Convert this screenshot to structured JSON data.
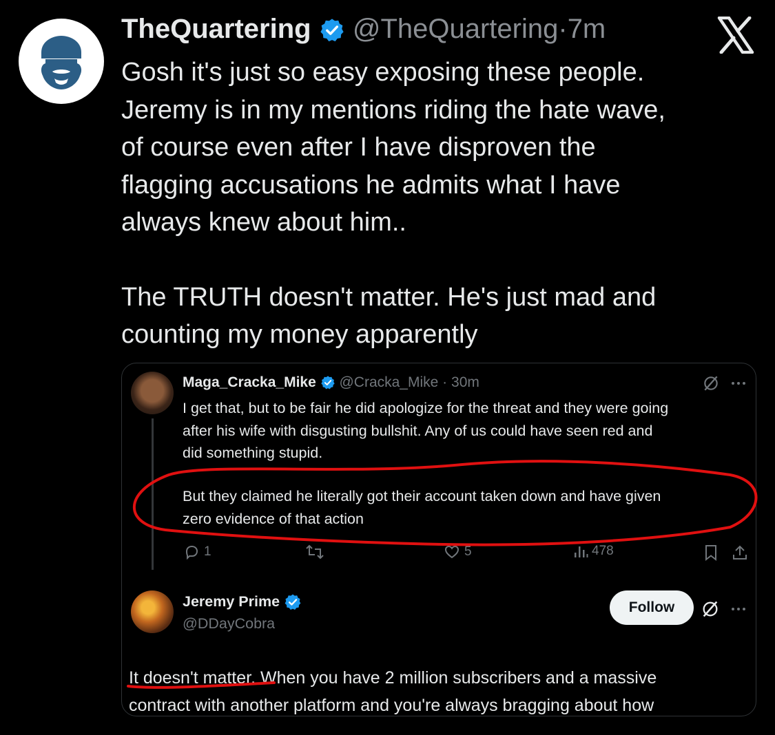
{
  "tweet": {
    "author_name": "TheQuartering",
    "author_handle": "@TheQuartering",
    "separator": "·",
    "time": "7m",
    "lines": [
      "Gosh it's just so easy exposing these people.",
      "Jeremy is in my mentions riding the hate wave,",
      "of course even after I have disproven the",
      "flagging accusations he admits what I have",
      "always knew about him.."
    ],
    "lines2": [
      "The TRUTH doesn't matter.  He's just mad and",
      "counting my money apparently"
    ]
  },
  "embed": {
    "post1": {
      "author_name": "Maga_Cracka_Mike",
      "author_handle": "@Cracka_Mike",
      "separator": "·",
      "time": "30m",
      "lines": [
        "I get that, but to be fair he did apologize for the threat and they were going",
        "after his wife with disgusting bullshit.  Any of us could have seen red and",
        "did something stupid."
      ],
      "lines2": [
        "But they claimed he literally got their account taken down and have given",
        "zero evidence of that action"
      ],
      "replies": "1",
      "likes": "5",
      "views": "478"
    },
    "post2": {
      "author_name": "Jeremy Prime",
      "author_handle": "@DDayCobra",
      "follow_label": "Follow",
      "lines": [
        "It doesn't matter. When you have 2 million subscribers and a massive",
        "contract with another platform and you're always bragging about how"
      ]
    }
  },
  "colors": {
    "verified": "#1d9bf0",
    "annotation": "#e01010",
    "background": "#000000"
  },
  "icons": [
    "x-logo-icon",
    "verified-icon",
    "grok-icon",
    "more-icon",
    "reply-icon",
    "repost-icon",
    "like-icon",
    "views-icon",
    "bookmark-icon",
    "share-icon"
  ]
}
